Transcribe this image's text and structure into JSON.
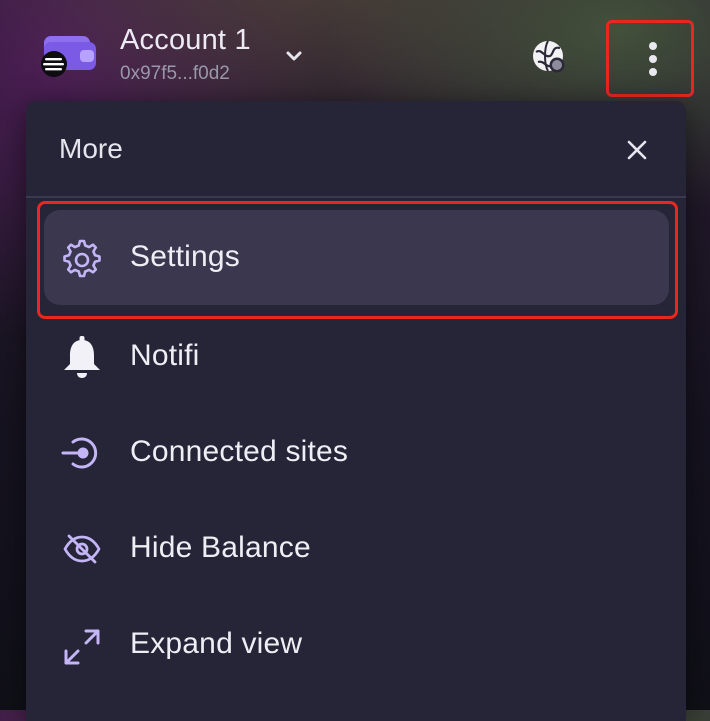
{
  "colors": {
    "accent": "#c4b5f7",
    "highlight_border": "#e8281f",
    "panel_bg": "#262437",
    "selected_bg": "#3a374f"
  },
  "header": {
    "account_name": "Account 1",
    "account_address": "0x97f5...f0d2",
    "icons": [
      "wallet-icon",
      "chevron-down-icon",
      "globe-icon",
      "more-vertical-icon"
    ]
  },
  "panel": {
    "title": "More",
    "close_icon": "close-icon",
    "items": [
      {
        "label": "Settings",
        "icon": "gear-icon",
        "selected": true
      },
      {
        "label": "Notifi",
        "icon": "bell-icon",
        "selected": false
      },
      {
        "label": "Connected sites",
        "icon": "connected-sites-icon",
        "selected": false
      },
      {
        "label": "Hide Balance",
        "icon": "eye-off-icon",
        "selected": false
      },
      {
        "label": "Expand view",
        "icon": "expand-icon",
        "selected": false
      }
    ]
  }
}
